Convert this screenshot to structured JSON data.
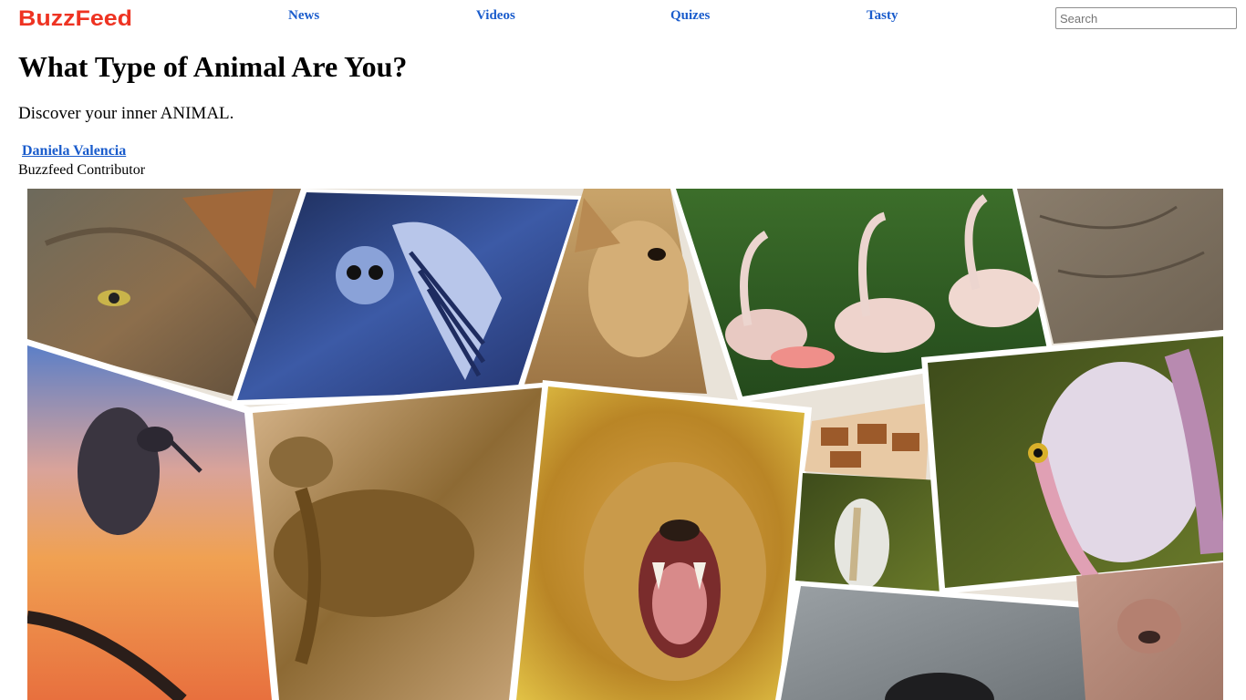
{
  "header": {
    "logo_text": "BuzzFeed",
    "nav": [
      {
        "label": "News"
      },
      {
        "label": "Videos"
      },
      {
        "label": "Quizes"
      },
      {
        "label": "Tasty"
      }
    ],
    "search": {
      "placeholder": "Search",
      "value": ""
    }
  },
  "article": {
    "title": "What Type of Animal Are You?",
    "subtitle": "Discover your inner ANIMAL.",
    "author": {
      "name": "Daniela Valencia",
      "role": "Buzzfeed Contributor"
    }
  },
  "collage": {
    "animals": [
      "wolf",
      "owl",
      "deer",
      "flamingos",
      "elephant",
      "heron",
      "baboon",
      "lion",
      "giraffe",
      "pelican",
      "pelican",
      "rock",
      "lioness"
    ]
  },
  "colors": {
    "brand": "#ee3322",
    "link": "#1a5ccc"
  }
}
